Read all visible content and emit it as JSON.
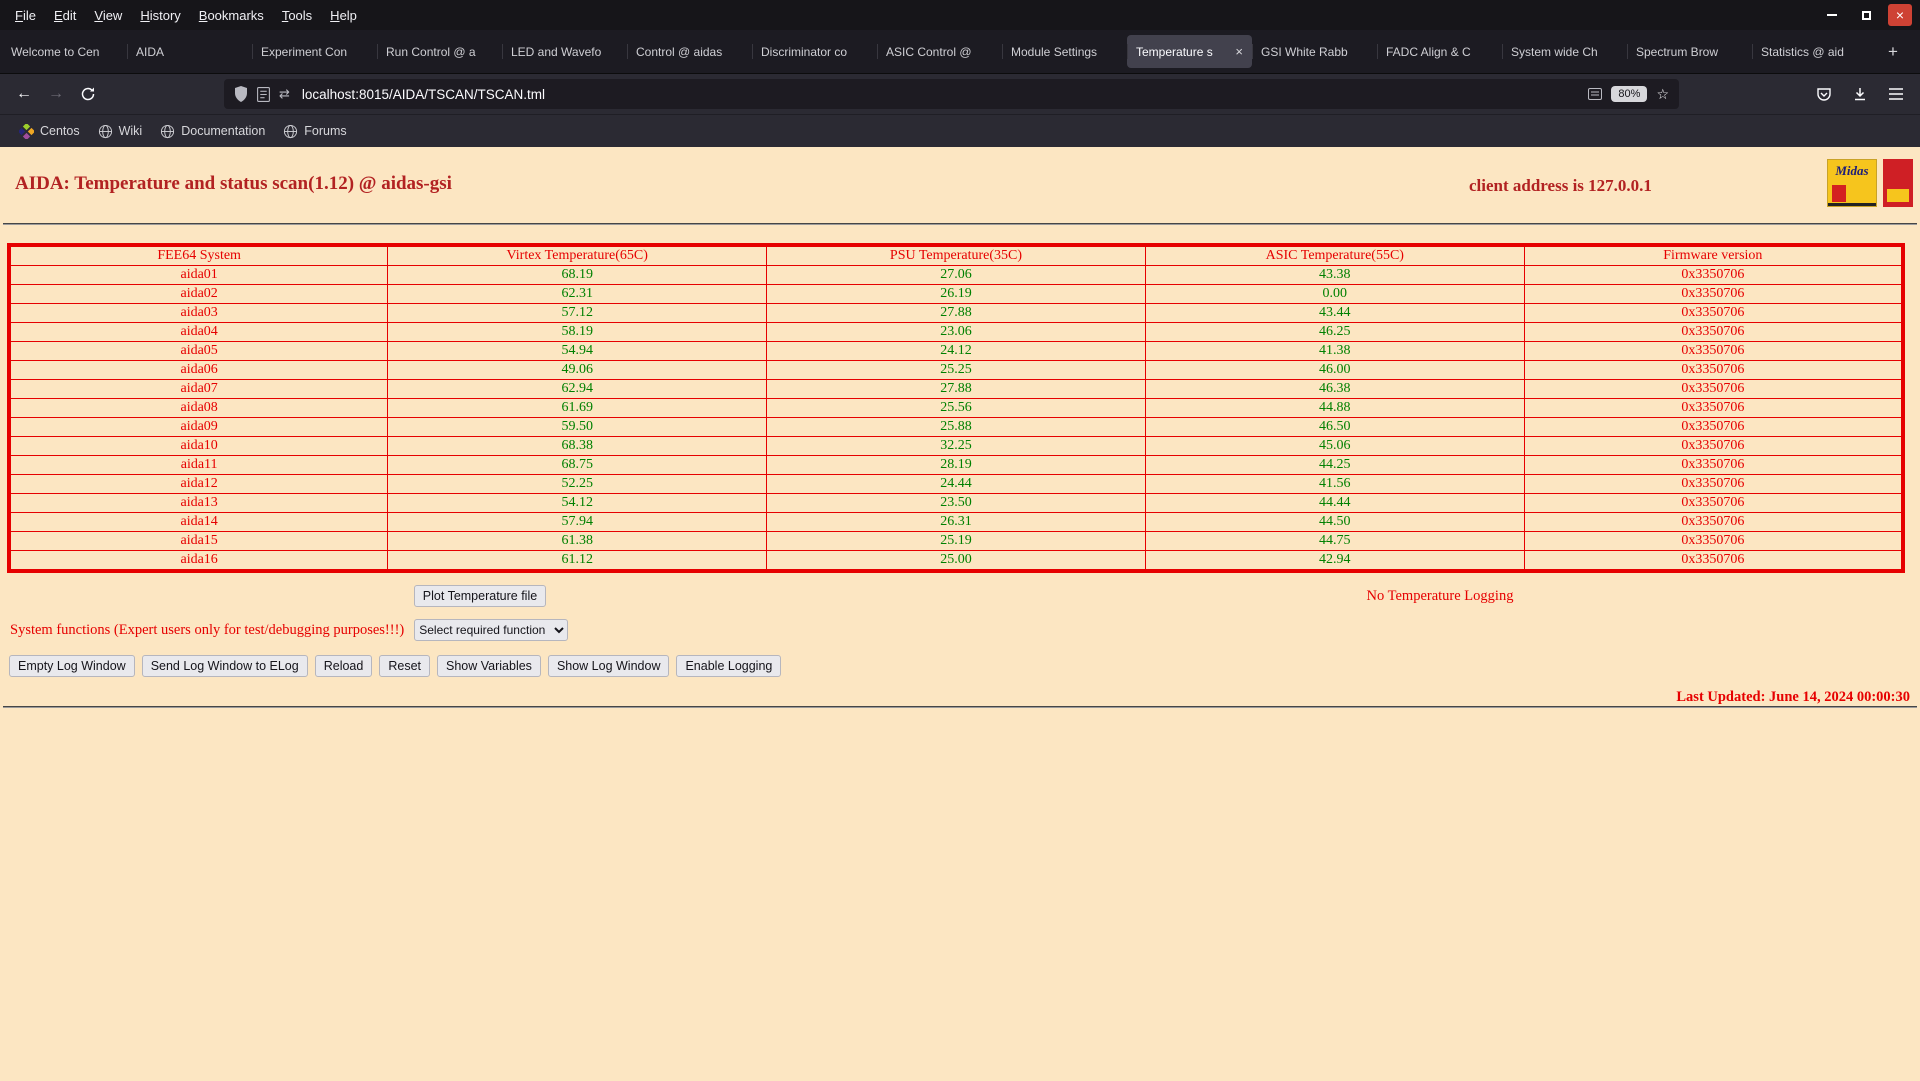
{
  "window": {
    "menu": [
      "File",
      "Edit",
      "View",
      "History",
      "Bookmarks",
      "Tools",
      "Help"
    ]
  },
  "icons": {
    "back": "←",
    "forward": "→",
    "close": "×",
    "tab_close": "×",
    "new_tab": "+",
    "star": "☆",
    "swap_arrows": "⇄"
  },
  "tabs": [
    {
      "label": "Welcome to Cen",
      "active": false
    },
    {
      "label": "AIDA",
      "active": false
    },
    {
      "label": "Experiment Con",
      "active": false
    },
    {
      "label": "Run Control @ a",
      "active": false
    },
    {
      "label": "LED and Wavefo",
      "active": false
    },
    {
      "label": "Control @ aidas",
      "active": false
    },
    {
      "label": "Discriminator co",
      "active": false
    },
    {
      "label": "ASIC Control @",
      "active": false
    },
    {
      "label": "Module Settings",
      "active": false
    },
    {
      "label": "Temperature s",
      "active": true
    },
    {
      "label": "GSI White Rabb",
      "active": false
    },
    {
      "label": "FADC Align & C",
      "active": false
    },
    {
      "label": "System wide Ch",
      "active": false
    },
    {
      "label": "Spectrum Brow",
      "active": false
    },
    {
      "label": "Statistics @ aid",
      "active": false
    }
  ],
  "navbar": {
    "url": "localhost:8015/AIDA/TSCAN/TSCAN.tml",
    "zoom": "80%"
  },
  "bookmarks": [
    "Centos",
    "Wiki",
    "Documentation",
    "Forums"
  ],
  "page": {
    "title": "AIDA: Temperature and status scan(1.12) @ aidas-gsi",
    "client_address": "client address is 127.0.0.1",
    "logo_text": "Midas",
    "table": {
      "headers": [
        "FEE64 System",
        "Virtex Temperature(65C)",
        "PSU Temperature(35C)",
        "ASIC Temperature(55C)",
        "Firmware version"
      ],
      "rows": [
        {
          "system": "aida01",
          "virtex": "68.19",
          "psu": "27.06",
          "asic": "43.38",
          "firmware": "0x3350706"
        },
        {
          "system": "aida02",
          "virtex": "62.31",
          "psu": "26.19",
          "asic": "0.00",
          "firmware": "0x3350706"
        },
        {
          "system": "aida03",
          "virtex": "57.12",
          "psu": "27.88",
          "asic": "43.44",
          "firmware": "0x3350706"
        },
        {
          "system": "aida04",
          "virtex": "58.19",
          "psu": "23.06",
          "asic": "46.25",
          "firmware": "0x3350706"
        },
        {
          "system": "aida05",
          "virtex": "54.94",
          "psu": "24.12",
          "asic": "41.38",
          "firmware": "0x3350706"
        },
        {
          "system": "aida06",
          "virtex": "49.06",
          "psu": "25.25",
          "asic": "46.00",
          "firmware": "0x3350706"
        },
        {
          "system": "aida07",
          "virtex": "62.94",
          "psu": "27.88",
          "asic": "46.38",
          "firmware": "0x3350706"
        },
        {
          "system": "aida08",
          "virtex": "61.69",
          "psu": "25.56",
          "asic": "44.88",
          "firmware": "0x3350706"
        },
        {
          "system": "aida09",
          "virtex": "59.50",
          "psu": "25.88",
          "asic": "46.50",
          "firmware": "0x3350706"
        },
        {
          "system": "aida10",
          "virtex": "68.38",
          "psu": "32.25",
          "asic": "45.06",
          "firmware": "0x3350706"
        },
        {
          "system": "aida11",
          "virtex": "68.75",
          "psu": "28.19",
          "asic": "44.25",
          "firmware": "0x3350706"
        },
        {
          "system": "aida12",
          "virtex": "52.25",
          "psu": "24.44",
          "asic": "41.56",
          "firmware": "0x3350706"
        },
        {
          "system": "aida13",
          "virtex": "54.12",
          "psu": "23.50",
          "asic": "44.44",
          "firmware": "0x3350706"
        },
        {
          "system": "aida14",
          "virtex": "57.94",
          "psu": "26.31",
          "asic": "44.50",
          "firmware": "0x3350706"
        },
        {
          "system": "aida15",
          "virtex": "61.38",
          "psu": "25.19",
          "asic": "44.75",
          "firmware": "0x3350706"
        },
        {
          "system": "aida16",
          "virtex": "61.12",
          "psu": "25.00",
          "asic": "42.94",
          "firmware": "0x3350706"
        }
      ]
    },
    "plot_button": "Plot Temperature file",
    "logging_status": "No Temperature Logging",
    "system_functions": "System functions (Expert users only for test/debugging purposes!!!)",
    "function_select": "Select required function",
    "actions": [
      "Empty Log Window",
      "Send Log Window to ELog",
      "Reload",
      "Reset",
      "Show Variables",
      "Show Log Window",
      "Enable Logging"
    ],
    "last_updated": "Last Updated: June 14, 2024 00:00:30"
  },
  "colors": {
    "page_bg": "#fce6c2",
    "heading_red": "#b22222",
    "text_red": "#e60000",
    "value_green": "#008000",
    "table_border": "#e60000"
  }
}
